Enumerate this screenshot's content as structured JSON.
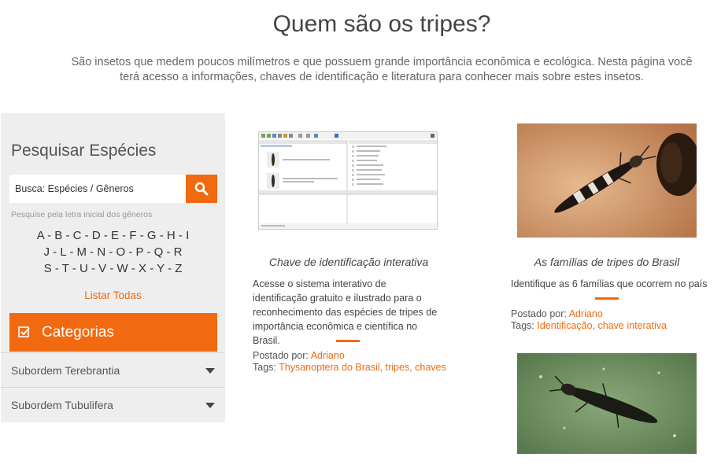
{
  "hero": {
    "title": "Quem são os tripes?",
    "text": "São insetos que medem poucos milímetros e que possuem grande importância econômica e ecológica. Nesta página você terá acesso a informações, chaves de identificação e literatura para conhecer mais sobre estes insetos."
  },
  "sidebar": {
    "title": "Pesquisar Espécies",
    "search_placeholder": "Busca: Espécies / Gêneros",
    "hint": "Pesquise pela letra inicial dos gêneros",
    "alphabet_rows": [
      [
        "A",
        "B",
        "C",
        "D",
        "E",
        "F",
        "G",
        "H",
        "I"
      ],
      [
        "J",
        "L",
        "M",
        "N",
        "O",
        "P",
        "Q",
        "R"
      ],
      [
        "S",
        "T",
        "U",
        "V",
        "W",
        "X",
        "Y",
        "Z"
      ]
    ],
    "list_all": "Listar Todas",
    "categories_label": "Categorias",
    "categories": [
      "Subordem Terebrantia",
      "Subordem Tubulifera"
    ]
  },
  "posts": [
    {
      "title": "Chave de identificação interativa",
      "excerpt": "Acesse o sistema interativo de identificação gratuito e ilustrado para o reconhecimento das espécies de tripes de importância econômica e científica no Brasil.",
      "posted_by_label": "Postado por:",
      "author": "Adriano",
      "tags_label": "Tags:",
      "tags": "Thysanoptera do Brasil, tripes, chaves"
    },
    {
      "title": "As famílias de tripes do Brasil",
      "excerpt": "Identifique as 6 famílias que ocorrem no país",
      "posted_by_label": "Postado por:",
      "author": "Adriano",
      "tags_label": "Tags:",
      "tags": "Identificação, chave interativa"
    }
  ],
  "colors": {
    "accent": "#f26a10",
    "sidebar_bg": "#eeeeee"
  },
  "icons": {
    "search": "search-icon",
    "categories": "checkbox-icon",
    "category_toggle": "caret-down-icon"
  }
}
